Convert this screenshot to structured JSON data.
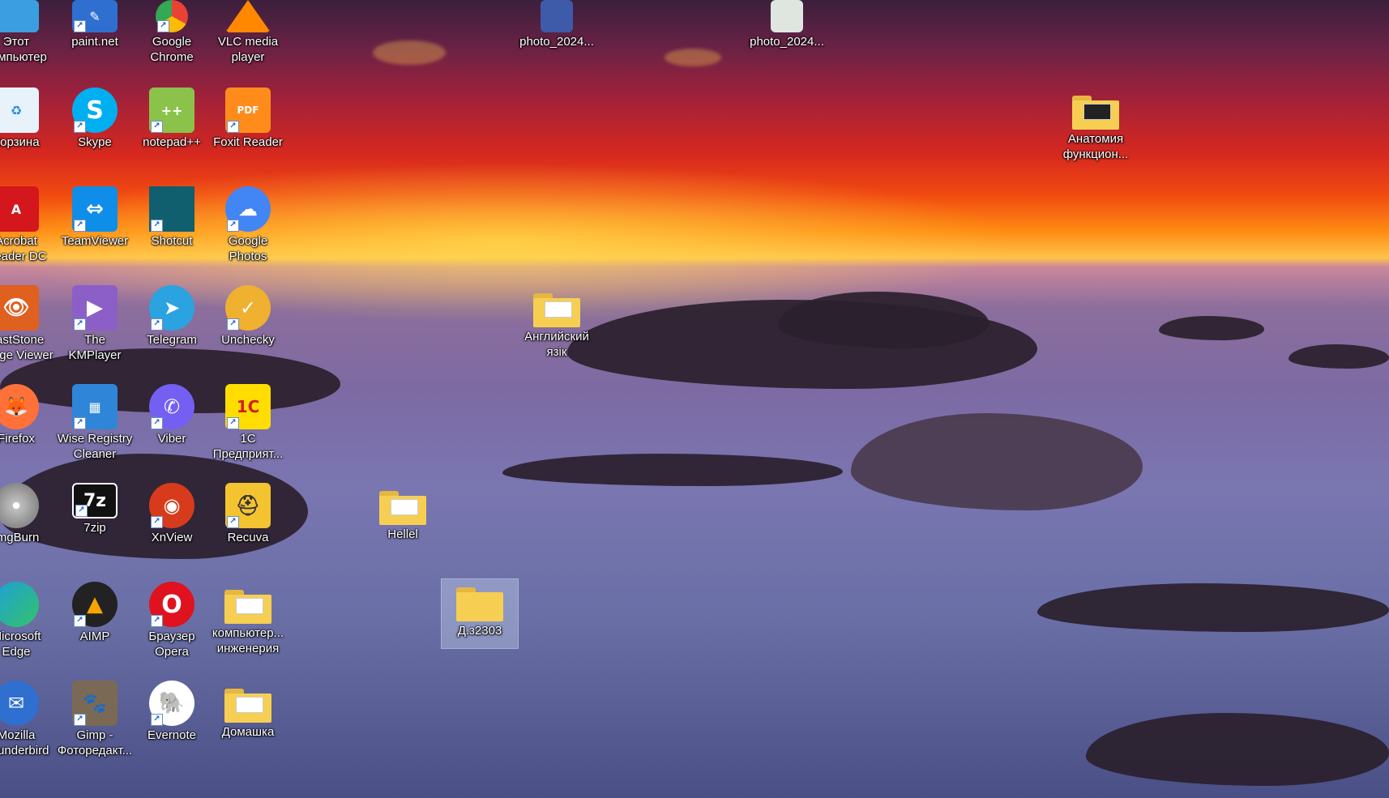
{
  "desktop": {
    "icons": [
      {
        "label": "Этот\nкомпьютер",
        "icon": "monitor-icon",
        "color": "#3a9ee0"
      },
      {
        "label": "paint.net",
        "icon": "paintnet-icon",
        "color": "#2f6fd0"
      },
      {
        "label": "Google\nChrome",
        "icon": "chrome-icon",
        "color": "#e94235"
      },
      {
        "label": "VLC media\nplayer",
        "icon": "vlc-icon",
        "color": "#ff8800"
      },
      {
        "label": "photo_2024...",
        "icon": "image-file-icon",
        "color": "#3d5ba9"
      },
      {
        "label": "photo_2024...",
        "icon": "image-file-icon",
        "color": "#dfe6df"
      },
      {
        "label": "Корзина",
        "icon": "recycle-bin-icon",
        "color": "#e8f2fb"
      },
      {
        "label": "Skype",
        "icon": "skype-icon",
        "color": "#00aff0"
      },
      {
        "label": "notepad++",
        "icon": "notepad-plus-icon",
        "color": "#8bc34a"
      },
      {
        "label": "Foxit Reader",
        "icon": "foxit-icon",
        "color": "#ff8c1a"
      },
      {
        "label": "Анатомия\nфункцион...",
        "icon": "folder-icon",
        "color": "#f6cf52"
      },
      {
        "label": "Acrobat\nReader DC",
        "icon": "acrobat-icon",
        "color": "#d4161d"
      },
      {
        "label": "TeamViewer",
        "icon": "teamviewer-icon",
        "color": "#0e8ee9"
      },
      {
        "label": "Shotcut",
        "icon": "shotcut-icon",
        "color": "#0f5f6e"
      },
      {
        "label": "Google\nPhotos",
        "icon": "cloud-upload-icon",
        "color": "#4285f4"
      },
      {
        "label": "FastStone\nImage Viewer",
        "icon": "faststone-icon",
        "color": "#e06020"
      },
      {
        "label": "The KMPlayer",
        "icon": "kmplayer-icon",
        "color": "#8c5fc8"
      },
      {
        "label": "Telegram",
        "icon": "telegram-icon",
        "color": "#2aa3e0"
      },
      {
        "label": "Unchecky",
        "icon": "unchecky-icon",
        "color": "#f0b030"
      },
      {
        "label": "Английский\nязік",
        "icon": "folder-icon",
        "color": "#f6cf52"
      },
      {
        "label": "Firefox",
        "icon": "firefox-icon",
        "color": "#ff7139"
      },
      {
        "label": "Wise Registry\nCleaner",
        "icon": "wise-registry-icon",
        "color": "#2f86d8"
      },
      {
        "label": "Viber",
        "icon": "viber-icon",
        "color": "#7360f2"
      },
      {
        "label": "1С\nПредприят...",
        "icon": "1c-icon",
        "color": "#ffdd00"
      },
      {
        "label": "ImgBurn",
        "icon": "imgburn-icon",
        "color": "#c0c0c0"
      },
      {
        "label": "7zip",
        "icon": "7zip-icon",
        "color": "#111111"
      },
      {
        "label": "XnView",
        "icon": "xnview-icon",
        "color": "#d83b1c"
      },
      {
        "label": "Recuva",
        "icon": "recuva-icon",
        "color": "#f4c430"
      },
      {
        "label": "Hellel",
        "icon": "folder-icon",
        "color": "#f6cf52"
      },
      {
        "label": "Microsoft\nEdge",
        "icon": "edge-icon",
        "color": "#1ca0d8"
      },
      {
        "label": "AIMP",
        "icon": "aimp-icon",
        "color": "#f7a500"
      },
      {
        "label": "Браузер\nOpera",
        "icon": "opera-icon",
        "color": "#e0121f"
      },
      {
        "label": "компьютер...\nинженерия",
        "icon": "folder-icon",
        "color": "#f6cf52"
      },
      {
        "label": "Д.з2303",
        "icon": "folder-icon",
        "color": "#f6cf52"
      },
      {
        "label": "Mozilla\nThunderbird",
        "icon": "thunderbird-icon",
        "color": "#2f6fd0"
      },
      {
        "label": "Gimp -\nФоторедакт...",
        "icon": "gimp-icon",
        "color": "#7a6a55"
      },
      {
        "label": "Evernote",
        "icon": "evernote-icon",
        "color": "#2dbe60"
      },
      {
        "label": "Домашка",
        "icon": "folder-icon",
        "color": "#f6cf52"
      }
    ]
  }
}
